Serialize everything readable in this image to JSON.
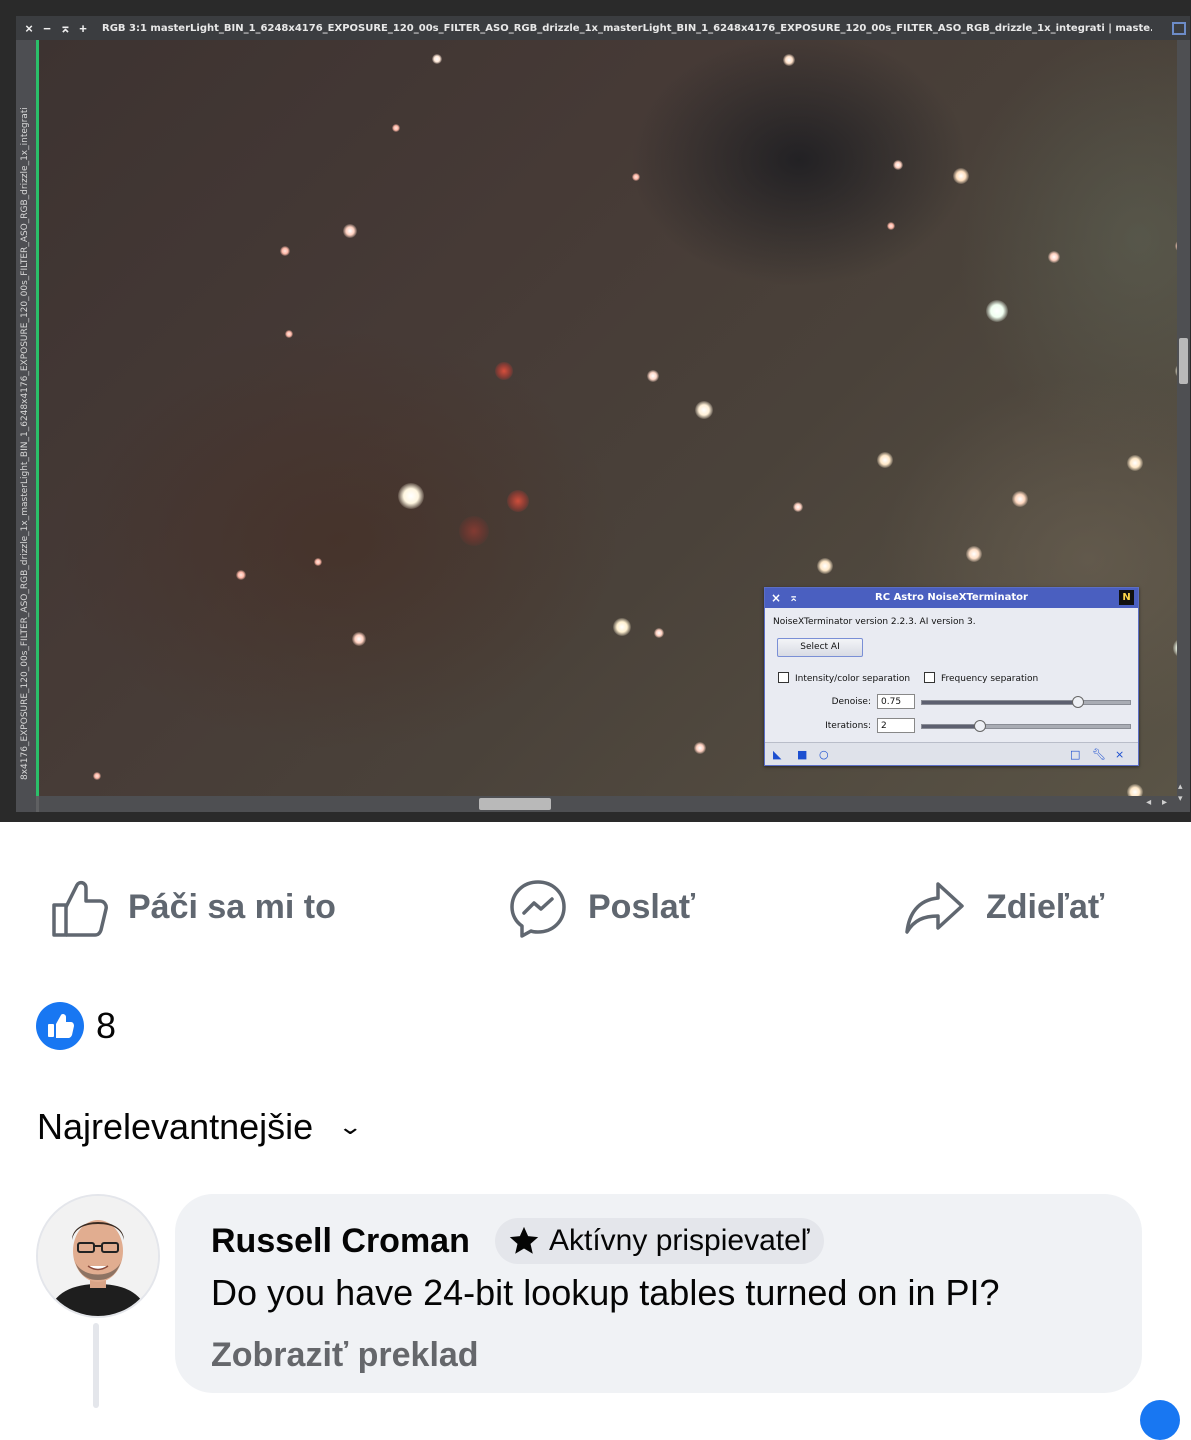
{
  "pixinsight": {
    "window_title": "RGB 3:1 masterLight_BIN_1_6248x4176_EXPOSURE_120_00s_FILTER_ASO_RGB_drizzle_1x_masterLight_BIN_1_6248x4176_EXPOSURE_120_00s_FILTER_ASO_RGB_drizzle_1x_integrati | maste...",
    "title_buttons": [
      "×",
      "−",
      "⌅",
      "+"
    ],
    "side_identifier": "8x4176_EXPOSURE_120_00s_FILTER_ASO_RGB_drizzle_1x_masterLight_BIN_1_6248x4176_EXPOSURE_120_00s_FILTER_ASO_RGB_drizzle_1x_integrati",
    "accent_color": "#2bbf6a"
  },
  "noisexterminator": {
    "title": "RC Astro NoiseXTerminator",
    "badge": "N",
    "close_glyph": "×",
    "shade_glyph": "⌅",
    "version_text": "NoiseXTerminator version 2.2.3. AI version 3.",
    "select_ai_label": "Select AI",
    "intensity_color_separation_label": "Intensity/color separation",
    "intensity_color_separation_checked": false,
    "frequency_separation_label": "Frequency separation",
    "frequency_separation_checked": false,
    "denoise_label": "Denoise:",
    "denoise_value": "0.75",
    "denoise_slider_fraction": 0.75,
    "iterations_label": "Iterations:",
    "iterations_value": "2",
    "iterations_slider_fraction": 0.28,
    "footer_icons": [
      "new-instance-icon",
      "apply-icon",
      "apply-global-icon",
      "preview-icon",
      "settings-icon",
      "reset-icon"
    ]
  },
  "post_actions": {
    "like_label": "Páči sa mi to",
    "send_label": "Poslať",
    "share_label": "Zdieľať"
  },
  "reactions": {
    "count": "8",
    "color": "#1877f2"
  },
  "comments": {
    "sort_label": "Najrelevantnejšie",
    "items": [
      {
        "author": "Russell Croman",
        "badge": "Aktívny prispievateľ",
        "text": "Do you have 24-bit lookup tables turned on in PI?",
        "translate_label": "Zobraziť preklad"
      }
    ]
  }
}
